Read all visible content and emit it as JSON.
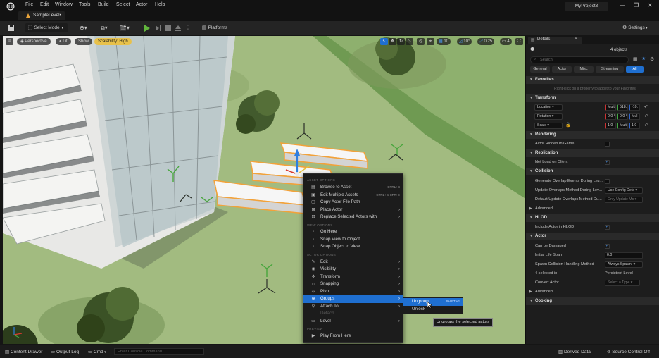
{
  "window": {
    "menu": [
      "File",
      "Edit",
      "Window",
      "Tools",
      "Build",
      "Select",
      "Actor",
      "Help"
    ],
    "level_tab": "SampleLevel•",
    "project_name": "MyProject3",
    "controls": [
      "—",
      "❐",
      "✕"
    ]
  },
  "toolbar": {
    "select_mode": "Select Mode",
    "platforms": "Platforms",
    "settings": "Settings"
  },
  "viewport": {
    "view_mode": "Perspective",
    "lighting": "Lit",
    "show": "Show",
    "scalability": "Scalability: High",
    "grid_snap": "10",
    "rotation_snap": "10°",
    "scale_snap": "0.25",
    "camera_speed": "4"
  },
  "context_menu": {
    "sections": {
      "asset_options": "ASSET OPTIONS",
      "view_options": "VIEW OPTIONS",
      "actor_options": "ACTOR OPTIONS",
      "preview": "PREVIEW"
    },
    "items": [
      {
        "label": "Browse to Asset",
        "shortcut": "CTRL+B",
        "icon": "browse-icon"
      },
      {
        "label": "Edit Multiple Assets",
        "shortcut": "CTRL+SHIFT+E",
        "icon": "edit-assets-icon"
      },
      {
        "label": "Copy Actor File Path",
        "icon": "copy-icon"
      },
      {
        "label": "Place Actor",
        "icon": "place-actor-icon",
        "submenu": true
      },
      {
        "label": "Replace Selected Actors with",
        "icon": "replace-icon",
        "submenu": true
      },
      {
        "label": "Go Here",
        "icon": "go-here-icon"
      },
      {
        "label": "Snap View to Object",
        "icon": "snap-view-icon"
      },
      {
        "label": "Snap Object to View",
        "icon": "snap-object-icon"
      },
      {
        "label": "Edit",
        "icon": "pencil-icon",
        "submenu": true
      },
      {
        "label": "Visibility",
        "icon": "eye-icon",
        "submenu": true
      },
      {
        "label": "Transform",
        "icon": "transform-icon",
        "submenu": true
      },
      {
        "label": "Snapping",
        "icon": "magnet-icon",
        "submenu": true
      },
      {
        "label": "Pivot",
        "icon": "pivot-icon",
        "submenu": true
      },
      {
        "label": "Groups",
        "icon": "groups-icon",
        "submenu": true,
        "highlighted": true
      },
      {
        "label": "Attach To",
        "icon": "attach-icon",
        "submenu": true
      },
      {
        "label": "Detach",
        "icon": "detach-icon",
        "disabled": true
      },
      {
        "label": "Level",
        "icon": "level-icon",
        "submenu": true
      },
      {
        "label": "Play From Here",
        "icon": "play-icon"
      }
    ]
  },
  "groups_submenu": {
    "items": [
      {
        "label": "Ungroup",
        "shortcut": "SHIFT+G"
      },
      {
        "label": "Unlock"
      }
    ],
    "tooltip": "Ungroups the selected actors"
  },
  "details": {
    "tab": "Details",
    "selection": "4 objects",
    "search_placeholder": "Search",
    "filters": [
      "General",
      "Actor",
      "Misc",
      "Streaming",
      "All"
    ],
    "active_filter": "All",
    "favorites": {
      "title": "Favorites",
      "hint": "Right-click on a property to add it to your Favorites."
    },
    "transform": {
      "title": "Transform",
      "location": {
        "label": "Location",
        "values": [
          "Mult",
          "518.",
          "-10."
        ]
      },
      "rotation": {
        "label": "Rotation",
        "values": [
          "0.0 °",
          "0.0 °",
          "Mul"
        ]
      },
      "scale": {
        "label": "Scale",
        "values": [
          "1.0",
          "Mult",
          "1.0"
        ]
      }
    },
    "rendering": {
      "title": "Rendering",
      "actor_hidden": "Actor Hidden In Game"
    },
    "replication": {
      "title": "Replication",
      "net_load": "Net Load on Client"
    },
    "collision": {
      "title": "Collision",
      "gen_overlap": "Generate Overlap Events During Lev...",
      "update_overlap": "Update Overlaps Method During Lev...",
      "update_overlap_value": "Use Config Defa",
      "default_update": "Default Update Overlaps Method Du...",
      "default_update_value": "Only Update Mc",
      "advanced": "Advanced"
    },
    "hlod": {
      "title": "HLOD",
      "include": "Include Actor in HLOD"
    },
    "actor": {
      "title": "Actor",
      "can_be_damaged": "Can be Damaged",
      "initial_life_span": "Initial Life Span",
      "initial_life_span_value": "0.0",
      "spawn_collision": "Spawn Collision Handling Method",
      "spawn_collision_value": "Always Spawn, ",
      "selected_in": "4 selected in",
      "selected_in_value": "Persistent Level",
      "convert_actor": "Convert Actor",
      "convert_actor_value": "Select a Type",
      "advanced": "Advanced"
    },
    "cooking": {
      "title": "Cooking"
    }
  },
  "statusbar": {
    "content_drawer": "Content Drawer",
    "output_log": "Output Log",
    "cmd": "Cmd",
    "console_placeholder": "Enter Console Command",
    "derived_data": "Derived Data",
    "source_control": "Source Control Off"
  },
  "colors": {
    "accent": "#1f6fd0",
    "scalability_badge": "#e8c14a",
    "grass": "#9bb77a",
    "selection_outline": "#f2a23a"
  }
}
